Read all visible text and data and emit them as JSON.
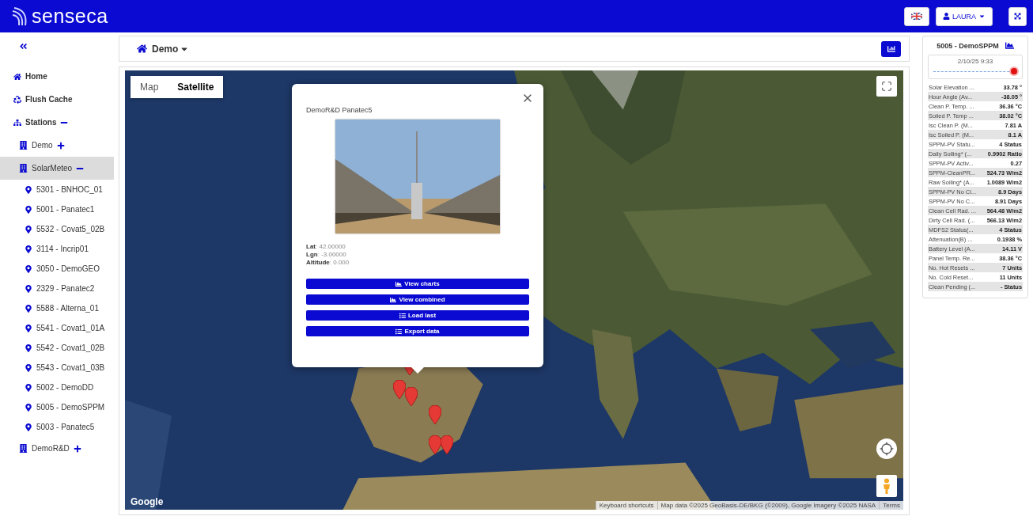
{
  "header": {
    "logo": "senseca",
    "user": "LAURA"
  },
  "sidebar": {
    "items": [
      {
        "kind": "link",
        "label": "Home"
      },
      {
        "kind": "link",
        "label": "Flush Cache"
      },
      {
        "kind": "group",
        "label": "Stations",
        "expanded": true,
        "children": [
          {
            "kind": "folder",
            "label": "Demo",
            "expanded": false,
            "selected": false
          },
          {
            "kind": "folder",
            "label": "SolarMeteo",
            "expanded": true,
            "selected": true,
            "children": [
              {
                "label": "5301 - BNHOC_01"
              },
              {
                "label": "5001 - Panatec1"
              },
              {
                "label": "5532 - Covat5_02B"
              },
              {
                "label": "3114 - Incrip01"
              },
              {
                "label": "3050 - DemoGEO"
              },
              {
                "label": "2329 - Panatec2"
              },
              {
                "label": "5588 - Alterna_01"
              },
              {
                "label": "5541 - Covat1_01A"
              },
              {
                "label": "5542 - Covat1_02B"
              },
              {
                "label": "5543 - Covat1_03B"
              },
              {
                "label": "5002 - DemoDD"
              },
              {
                "label": "5005 - DemoSPPM"
              },
              {
                "label": "5003 - Panatec5"
              }
            ]
          },
          {
            "kind": "folder",
            "label": "DemoR&D",
            "expanded": false,
            "selected": false
          }
        ]
      }
    ]
  },
  "breadcrumb": {
    "label": "Demo"
  },
  "map": {
    "map_types": [
      {
        "label": "Map",
        "selected": false
      },
      {
        "label": "Satellite",
        "selected": true
      }
    ],
    "popup": {
      "title": "DemoR&D Panatec5",
      "picture": {
        "kind": "picture"
      },
      "details": [
        "**Lat**: 42.00000",
        "**Lgn**: -3.00000",
        "**Altitude**: 0.000"
      ],
      "buttons": [
        {
          "label": "View charts"
        },
        {
          "label": "View combined"
        },
        {
          "label": "Load last"
        },
        {
          "label": "Export data"
        }
      ]
    },
    "logo": "Google",
    "attribution": [
      "Keyboard shortcuts",
      "Map data ©2025 GeoBasis-DE/BKG (©2009), Google Imagery ©2025 NASA",
      "Terms"
    ]
  },
  "station_panel": {
    "title": "5005 - DemoSPPM",
    "timestamp": "2/10/25 9:33",
    "time_slider": {
      "level": 1
    },
    "readings": [
      {
        "label": "Solar Elevation ...",
        "value": "33.78 °"
      },
      {
        "label": "Hour Angle (Av...",
        "value": "-38.05 °"
      },
      {
        "label": "Clean P. Temp. ...",
        "value": "36.36 °C"
      },
      {
        "label": "Soiled P. Temp ...",
        "value": "38.02 °C"
      },
      {
        "label": "Isc Clean P. (M...",
        "value": "7.81 A"
      },
      {
        "label": "Isc Soiled P. (M...",
        "value": "8.1 A"
      },
      {
        "label": "SPPM-PV Statu...",
        "value": "4 Status"
      },
      {
        "label": "Daily Soiling* (...",
        "value": "0.9902 Ratio"
      },
      {
        "label": "SPPM-PV Activ...",
        "value": "0.27"
      },
      {
        "label": "SPPM-CleanPR...",
        "value": "524.73 W/m2"
      },
      {
        "label": "Raw Soiling* (A...",
        "value": "1.0089 W/m2"
      },
      {
        "label": "SPPM-PV No Cl...",
        "value": "8.9 Days"
      },
      {
        "label": "SPPM-PV No C...",
        "value": "8.91 Days"
      },
      {
        "label": "Clean Cell Rad. ...",
        "value": "564.48 W/m2"
      },
      {
        "label": "Dirty Cell Rad. (...",
        "value": "566.13 W/m2"
      },
      {
        "label": "MDFS2 Status(...",
        "value": "4 Status"
      },
      {
        "label": "Attenuation(B) ...",
        "value": "0.1938 %"
      },
      {
        "label": "Battery Level (A...",
        "value": "14.11 V"
      },
      {
        "label": "Panel Temp. Re...",
        "value": "38.36 °C"
      },
      {
        "label": "No. Hot Resets ...",
        "value": "7 Units"
      },
      {
        "label": "No. Cold Reset...",
        "value": "11 Units"
      },
      {
        "label": "Clean Pending (...",
        "value": "- Status"
      }
    ]
  }
}
